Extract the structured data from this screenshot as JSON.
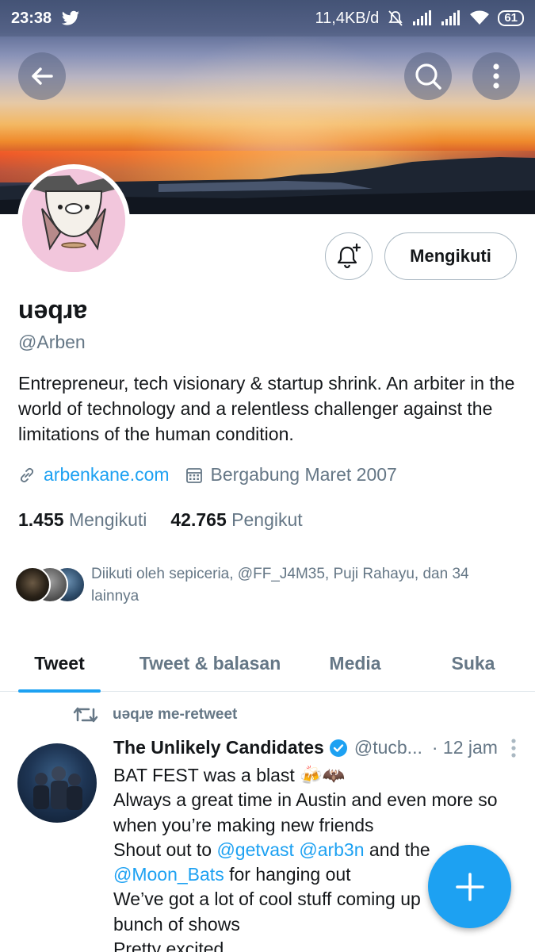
{
  "status_bar": {
    "time": "23:38",
    "network_speed": "11,4KB/d",
    "battery": "61"
  },
  "profile": {
    "display_name": "uəqɹɐ",
    "handle": "@Arben",
    "bio": "Entrepreneur, tech visionary & startup shrink. An arbiter in the world of technology and a relentless challenger against the limitations of the human condition.",
    "website": "arbenkane.com",
    "joined": "Bergabung Maret 2007",
    "following_count": "1.455",
    "following_label": "Mengikuti",
    "followers_count": "42.765",
    "followers_label": "Pengikut",
    "follow_button_label": "Mengikuti",
    "followed_by_text": "Diikuti oleh sepiceria, @FF_J4M35, Puji Rahayu, dan 34 lainnya"
  },
  "tabs": [
    {
      "label": "Tweet",
      "active": true
    },
    {
      "label": "Tweet & balasan",
      "active": false
    },
    {
      "label": "Media",
      "active": false
    },
    {
      "label": "Suka",
      "active": false
    }
  ],
  "tweet": {
    "retweet_line": "uəqɹɐ me-retweet",
    "author": "The Unlikely Candidates",
    "username": "@tucb...",
    "time": "· 12 jam",
    "lines": {
      "l1": "BAT FEST was a blast 🍻🦇",
      "l2": "Always a great time in Austin and even more so",
      "l3": "when you’re making new friends",
      "l4_pre": "Shout out to ",
      "m1": "@getvast",
      "m2": "@arb3n",
      "l4_post": " and the",
      "m3": "@Moon_Bats",
      "l5_post": " for hanging out",
      "l6": "We’ve got a lot of cool stuff coming up",
      "l7": "bunch of shows",
      "l8": "Pretty excited"
    }
  },
  "colors": {
    "accent": "#1da1f2",
    "secondary_text": "#657786",
    "primary_text": "#14171a"
  },
  "icons": [
    "back-arrow-icon",
    "search-icon",
    "more-vertical-icon",
    "bell-plus-icon",
    "link-icon",
    "calendar-icon",
    "retweet-icon",
    "verified-badge-icon",
    "compose-plus-icon"
  ]
}
